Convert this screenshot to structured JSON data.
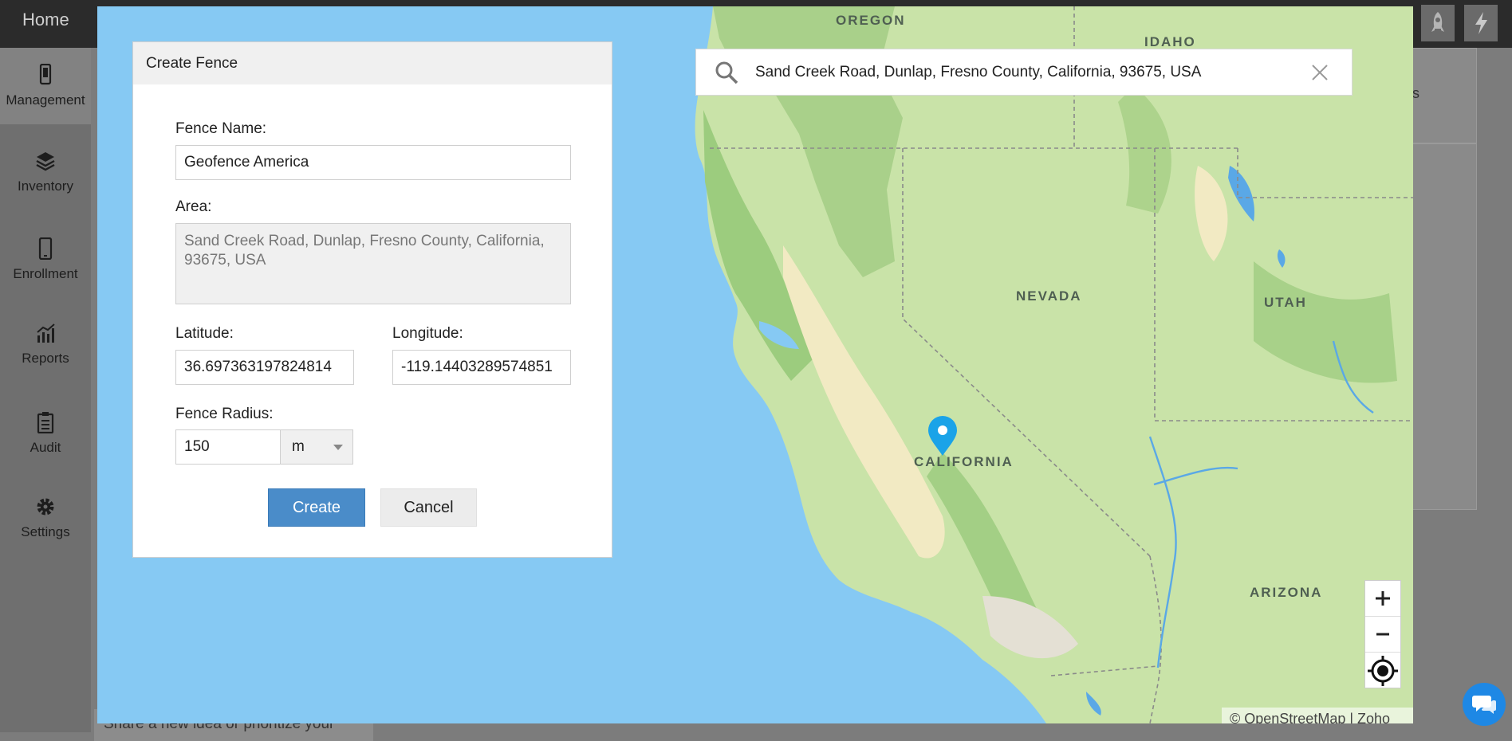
{
  "topbar": {
    "home_label": "Home"
  },
  "nav": [
    {
      "label": "Management",
      "icon": "mobile-icon"
    },
    {
      "label": "Inventory",
      "icon": "layers-icon"
    },
    {
      "label": "Enrollment",
      "icon": "phone-icon"
    },
    {
      "label": "Reports",
      "icon": "bar-chart-icon"
    },
    {
      "label": "Audit",
      "icon": "clipboard-icon"
    },
    {
      "label": "Settings",
      "icon": "gear-icon"
    }
  ],
  "background": {
    "snippet": "Share a new idea or prioritize your",
    "right_fragment": "s"
  },
  "dialog": {
    "title": "Create Fence",
    "fence_name_label": "Fence Name:",
    "fence_name_value": "Geofence America",
    "area_label": "Area:",
    "area_value": "Sand Creek Road, Dunlap, Fresno County, California, 93675, USA",
    "latitude_label": "Latitude:",
    "latitude_value": "36.697363197824814",
    "longitude_label": "Longitude:",
    "longitude_value": "-119.14403289574851",
    "radius_label": "Fence Radius:",
    "radius_value": "150",
    "radius_unit": "m",
    "create_label": "Create",
    "cancel_label": "Cancel"
  },
  "map": {
    "search_value": "Sand Creek Road, Dunlap, Fresno County, California, 93675, USA",
    "labels": [
      "OREGON",
      "IDAHO",
      "NEVADA",
      "UTAH",
      "CALIFORNIA",
      "ARIZONA"
    ],
    "attribution": "© OpenStreetMap |  Zoho Maps Attributions",
    "marker_color": "#1aa3e8",
    "water_color": "#86c9f3",
    "land_color": "#c9e3a8"
  }
}
